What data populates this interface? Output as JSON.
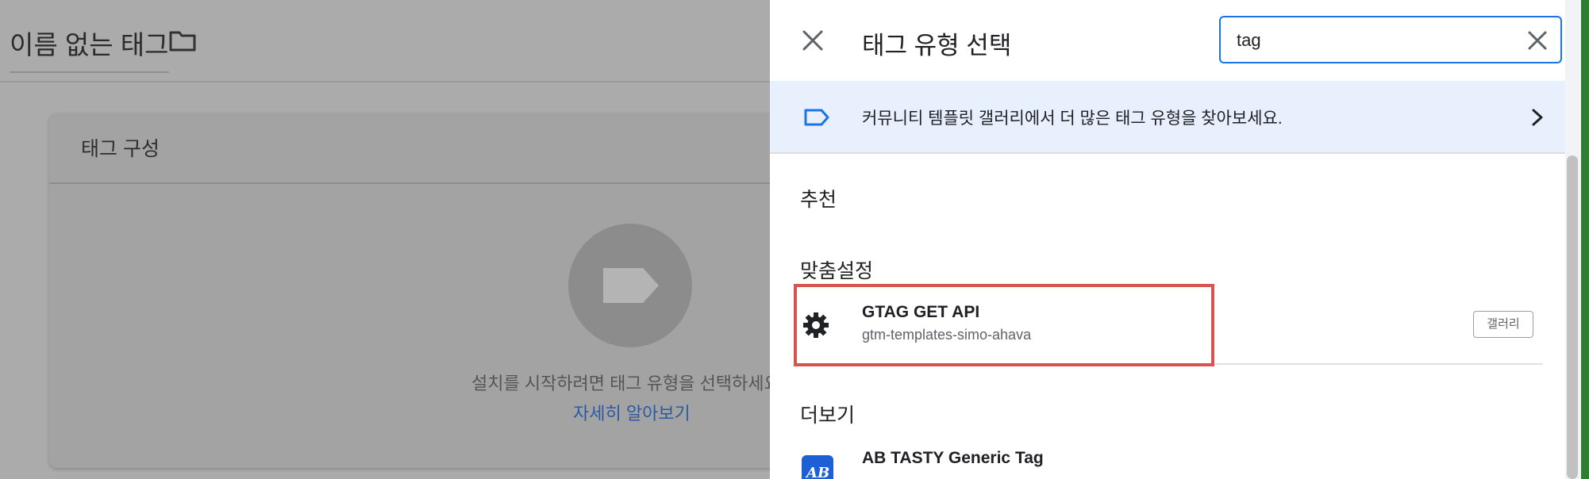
{
  "background_editor": {
    "tag_name": "이름 없는 태그",
    "card_title": "태그 구성",
    "hint_text": "설치를 시작하려면 태그 유형을 선택하세요",
    "learn_more": "자세히 알아보기"
  },
  "panel": {
    "title": "태그 유형 선택",
    "search": {
      "value": "tag"
    },
    "gallery_banner": {
      "text": "커뮤니티 템플릿 갤러리에서 더 많은 태그 유형을 찾아보세요."
    },
    "sections": {
      "recommended": "추천",
      "custom": "맞춤설정",
      "more": "더보기"
    },
    "custom_items": [
      {
        "name": "GTAG GET API",
        "subtitle": "gtm-templates-simo-ahava",
        "badge": "갤러리",
        "icon": "gear-icon"
      }
    ],
    "more_items": [
      {
        "name": "AB TASTY Generic Tag",
        "icon": "abtasty-logo"
      }
    ]
  },
  "colors": {
    "accent": "#1a73e8",
    "highlight": "#d9534f",
    "banner_bg": "#e8f0fe",
    "overlay": "#ababab"
  }
}
